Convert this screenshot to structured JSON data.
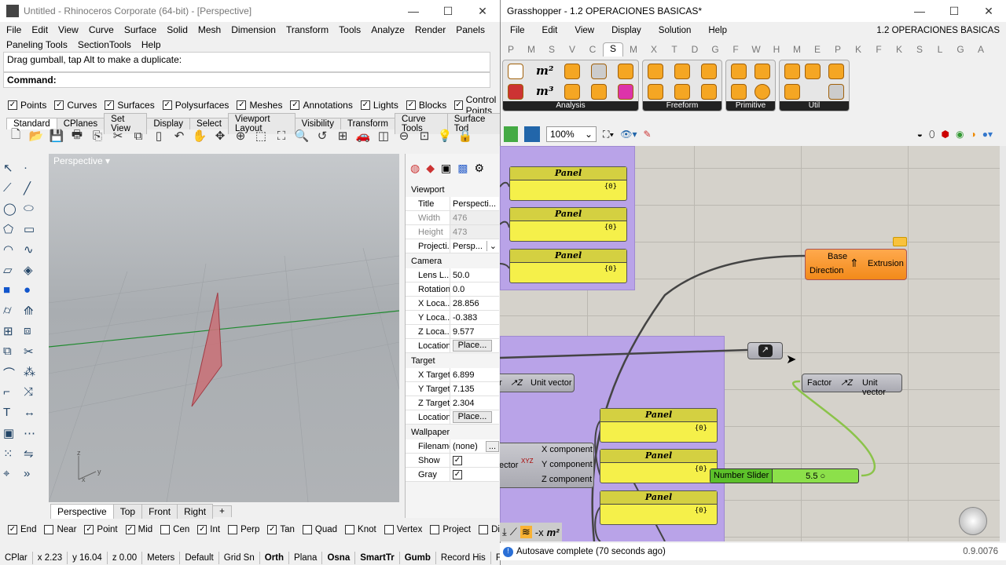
{
  "rhino": {
    "title": "Untitled - Rhinoceros Corporate (64-bit) - [Perspective]",
    "menu1": [
      "File",
      "Edit",
      "View",
      "Curve",
      "Surface",
      "Solid",
      "Mesh",
      "Dimension",
      "Transform",
      "Tools",
      "Analyze",
      "Render",
      "Panels"
    ],
    "menu2": [
      "Paneling Tools",
      "SectionTools",
      "Help"
    ],
    "history": "Drag gumball, tap Alt to make a duplicate:",
    "command": "Command:",
    "filters": [
      "Points",
      "Curves",
      "Surfaces",
      "Polysurfaces",
      "Meshes",
      "Annotations",
      "Lights",
      "Blocks",
      "Control Points"
    ],
    "tabs": [
      "Standard",
      "CPlanes",
      "Set View",
      "Display",
      "Select",
      "Viewport Layout",
      "Visibility",
      "Transform",
      "Curve Tools",
      "Surface Tod"
    ],
    "viewport_label": "Perspective",
    "view_tabs": [
      "Perspective",
      "Top",
      "Front",
      "Right"
    ],
    "osnaps": [
      {
        "l": "End",
        "c": true
      },
      {
        "l": "Near",
        "c": false
      },
      {
        "l": "Point",
        "c": true
      },
      {
        "l": "Mid",
        "c": true
      },
      {
        "l": "Cen",
        "c": false
      },
      {
        "l": "Int",
        "c": true
      },
      {
        "l": "Perp",
        "c": false
      },
      {
        "l": "Tan",
        "c": true
      },
      {
        "l": "Quad",
        "c": false
      },
      {
        "l": "Knot",
        "c": false
      },
      {
        "l": "Vertex",
        "c": false
      },
      {
        "l": "Project",
        "c": false
      },
      {
        "l": "Disable",
        "c": false
      }
    ],
    "status": [
      "CPlar",
      "x 2.23",
      "y 16.04",
      "z 0.00",
      "Meters",
      "Default",
      "Grid Sn",
      "Orth",
      "Plana",
      "Osna",
      "SmartTr",
      "Gumb",
      "Record His",
      "Fil"
    ],
    "props": {
      "viewport": "Viewport",
      "title_k": "Title",
      "title_v": "Perspecti...",
      "width_k": "Width",
      "width_v": "476",
      "height_k": "Height",
      "height_v": "473",
      "proj_k": "Projecti...",
      "proj_v": "Persp...",
      "camera": "Camera",
      "lens_k": "Lens L...",
      "lens_v": "50.0",
      "rot_k": "Rotation",
      "rot_v": "0.0",
      "xl_k": "X Loca...",
      "xl_v": "28.856",
      "yl_k": "Y Loca...",
      "yl_v": "-0.383",
      "zl_k": "Z Loca...",
      "zl_v": "9.577",
      "loc_k": "Location",
      "place": "Place...",
      "target": "Target",
      "xt_k": "X Target",
      "xt_v": "6.899",
      "yt_k": "Y Target",
      "yt_v": "7.135",
      "zt_k": "Z Target",
      "zt_v": "2.304",
      "wallpaper": "Wallpaper",
      "fn_k": "Filename",
      "fn_v": "(none)",
      "fn_btn": "...",
      "show_k": "Show",
      "gray_k": "Gray"
    }
  },
  "gh": {
    "title": "Grasshopper - 1.2 OPERACIONES BASICAS*",
    "menu": [
      "File",
      "Edit",
      "View",
      "Display",
      "Solution",
      "Help"
    ],
    "doc": "1.2 OPERACIONES BASICAS",
    "tabs": [
      "P",
      "M",
      "S",
      "V",
      "C",
      "S",
      "M",
      "X",
      "T",
      "D",
      "G",
      "F",
      "W",
      "H",
      "M",
      "E",
      "P",
      "K",
      "F",
      "K",
      "S",
      "L",
      "G",
      "A"
    ],
    "groups": [
      "Analysis",
      "Freeform",
      "Primitive",
      "Util"
    ],
    "zoom": "100%",
    "panel_title": "Panel",
    "panel_val": "{0}",
    "extrusion": {
      "in1": "Base",
      "in2": "Direction",
      "out": "Extrusion"
    },
    "unit1": {
      "in": "r",
      "out": "Unit vector"
    },
    "unit2": {
      "in": "Factor",
      "out": "Unit vector"
    },
    "decon": {
      "in": "ector",
      "o1": "X component",
      "o2": "Y component",
      "o3": "Z component"
    },
    "slider": {
      "label": "Number Slider",
      "value": "5.5"
    },
    "status": "Autosave complete (70 seconds ago)",
    "version": "0.9.0076"
  }
}
